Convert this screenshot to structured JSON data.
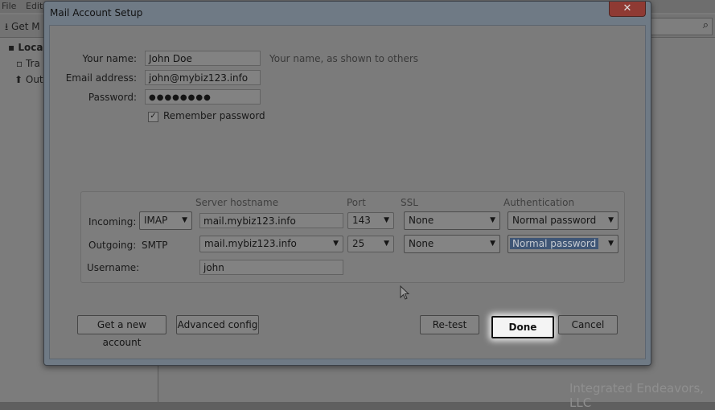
{
  "background": {
    "menu": [
      "File",
      "Edit"
    ],
    "toolbar_get_mail": "Get M",
    "folders": [
      "Loca",
      "Tra",
      "Out"
    ],
    "watermark": "Integrated Endeavors, LLC"
  },
  "dialog": {
    "title": "Mail Account Setup",
    "close_glyph": "✕",
    "fields": {
      "name_label": "Your name:",
      "name_value": "John Doe",
      "name_hint": "Your name, as shown to others",
      "email_label": "Email address:",
      "email_value": "john@mybiz123.info",
      "password_label": "Password:",
      "password_value": "●●●●●●●●",
      "remember_label": "Remember password",
      "remember_checked": "✓"
    },
    "server": {
      "col_hostname": "Server hostname",
      "col_port": "Port",
      "col_ssl": "SSL",
      "col_auth": "Authentication",
      "incoming": {
        "label": "Incoming:",
        "protocol": "IMAP",
        "hostname": "mail.mybiz123.info",
        "port": "143",
        "ssl": "None",
        "auth": "Normal password"
      },
      "outgoing": {
        "label": "Outgoing:",
        "protocol": "SMTP",
        "hostname": "mail.mybiz123.info",
        "port": "25",
        "ssl": "None",
        "auth": "Normal password"
      },
      "username_label": "Username:",
      "username_value": "john"
    },
    "buttons": {
      "new_account": "Get a new account",
      "advanced": "Advanced config",
      "retest": "Re-test",
      "done": "Done",
      "cancel": "Cancel"
    }
  }
}
